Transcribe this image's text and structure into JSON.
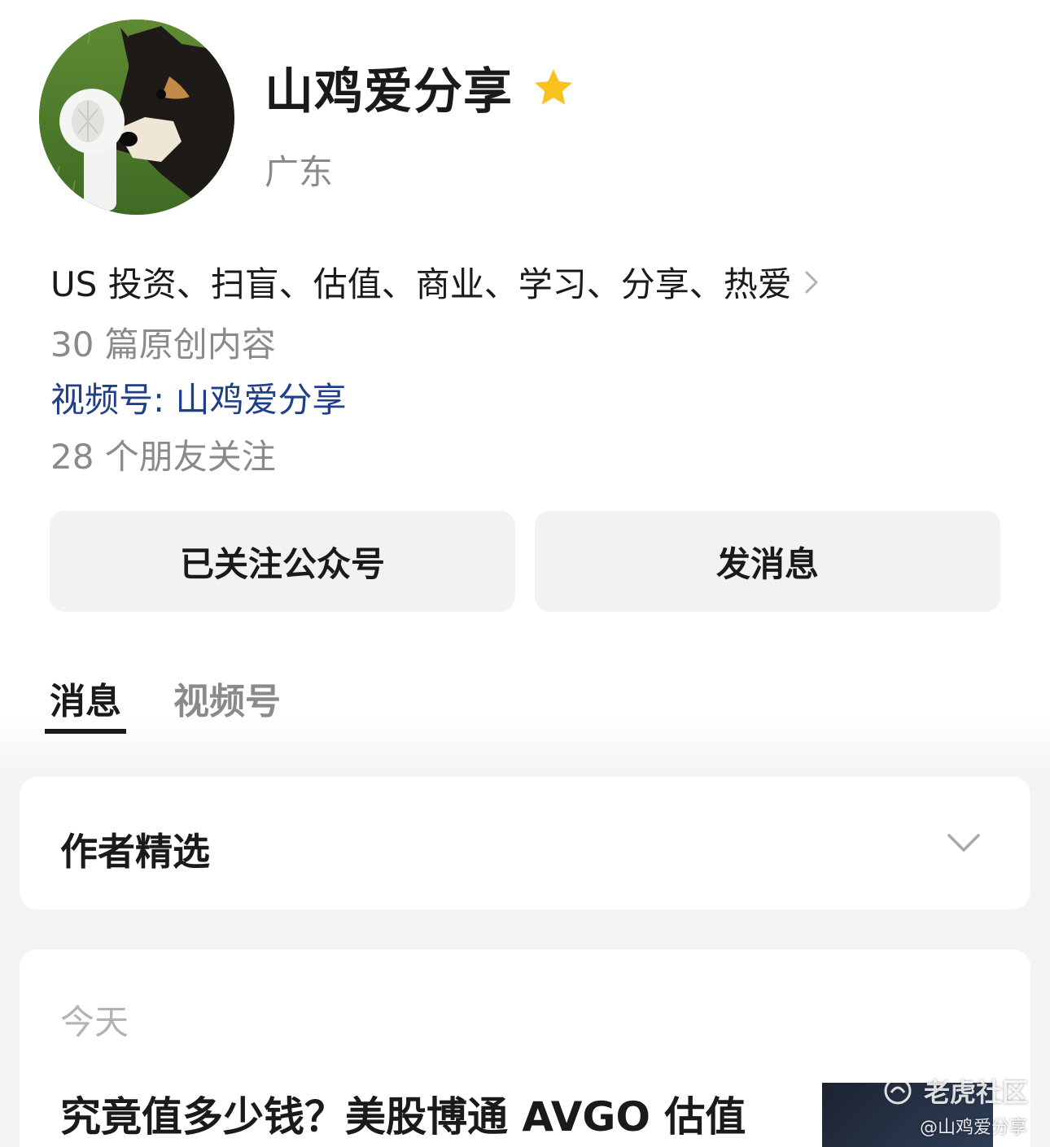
{
  "profile": {
    "name": "山鸡爱分享",
    "region": "广东",
    "bio": "US 投资、扫盲、估值、商业、学习、分享、热爱",
    "articles": "30 篇原创内容",
    "channel": "视频号: 山鸡爱分享",
    "friends": "28 个朋友关注",
    "avatar_icon": "dog-avatar",
    "star_icon": "star-icon",
    "star_color": "#f7c21b"
  },
  "actions": {
    "follow_label": "已关注公众号",
    "message_label": "发消息"
  },
  "tabs": [
    {
      "label": "消息",
      "active": true
    },
    {
      "label": "视频号",
      "active": false
    }
  ],
  "picks": {
    "title": "作者精选",
    "toggle_icon": "chevron-down-icon"
  },
  "feed": {
    "date": "今天",
    "article_title": "究竟值多少钱？美股博通 AVGO 估值"
  },
  "watermark": {
    "brand": "老虎社区",
    "handle": "@山鸡爱分享"
  },
  "colors": {
    "link": "#1f3f8a",
    "muted": "#8a8a8a",
    "button_bg": "#f2f2f2",
    "page_bg": "#f3f3f3"
  }
}
